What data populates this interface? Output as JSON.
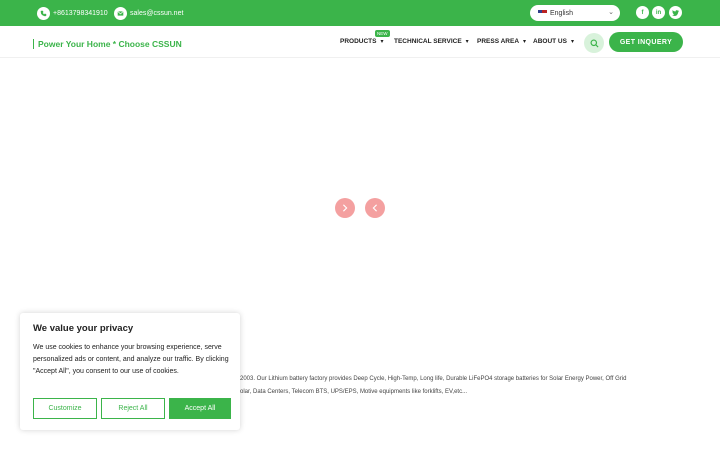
{
  "topbar": {
    "phone": "+8613798341910",
    "email": "sales@cssun.net",
    "language": "English",
    "social": [
      "f",
      "in",
      "t"
    ]
  },
  "header": {
    "tagline": "Power Your Home * Choose CSSUN",
    "nav": [
      {
        "label": "PRODUCTS",
        "badge": "NEW"
      },
      {
        "label": "TECHNICAL SERVICE"
      },
      {
        "label": "PRESS AREA"
      },
      {
        "label": "ABOUT US"
      }
    ],
    "cta": "GET INQUERY"
  },
  "about": {
    "line1": "2003. Our Lithium battery factory provides Deep Cycle, High-Temp, Long life, Durable LiFePO4 storage batteries for Solar Energy Power, Off Grid",
    "line2": "olar, Data Centers, Telecom BTS, UPS/EPS, Motive equipments like forklifts, EV,etc..."
  },
  "cookie": {
    "title": "We value your privacy",
    "text": "We use cookies to enhance your browsing experience, serve personalized ads or content, and analyze our traffic. By clicking \"Accept All\", you consent to our use of cookies.",
    "customize": "Customize",
    "reject": "Reject All",
    "accept": "Accept All"
  },
  "colors": {
    "brand": "#3bb44a",
    "arrow": "#f4a0a0"
  }
}
